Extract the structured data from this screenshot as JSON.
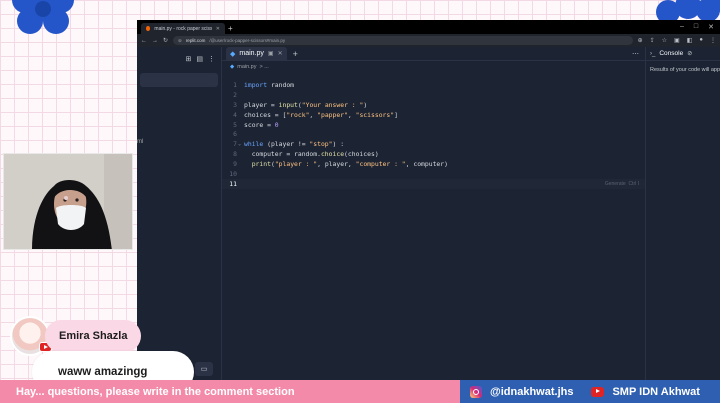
{
  "browser": {
    "tab_title": "main.py - rock paper scissors",
    "url_host": "replit.com",
    "url_path": "/@user/rock-papper-scissors#main.py"
  },
  "editor": {
    "tab_label": "main.py",
    "breadcrumb_file": "main.py",
    "breadcrumb_rest": "> ...",
    "generate_hint": "Generate  Ctrl I",
    "lines": [
      {
        "n": "1",
        "parts": [
          [
            "kw",
            "import"
          ],
          [
            "t",
            " random"
          ]
        ]
      },
      {
        "n": "2",
        "parts": []
      },
      {
        "n": "3",
        "parts": [
          [
            "t",
            "player = "
          ],
          [
            "fn",
            "input"
          ],
          [
            "t",
            "("
          ],
          [
            "str",
            "\"Your answer : \""
          ],
          [
            "t",
            ")"
          ]
        ]
      },
      {
        "n": "4",
        "parts": [
          [
            "t",
            "choices = ["
          ],
          [
            "str",
            "\"rock\""
          ],
          [
            "t",
            ", "
          ],
          [
            "str",
            "\"papper\""
          ],
          [
            "t",
            ", "
          ],
          [
            "str",
            "\"scissors\""
          ],
          [
            "t",
            "]"
          ]
        ]
      },
      {
        "n": "5",
        "parts": [
          [
            "t",
            "score = "
          ],
          [
            "num-lit",
            "0"
          ]
        ]
      },
      {
        "n": "6",
        "parts": []
      },
      {
        "n": "7",
        "parts": [
          [
            "kw",
            "while"
          ],
          [
            "t",
            " (player != "
          ],
          [
            "str",
            "\"stop\""
          ],
          [
            "t",
            ") :"
          ]
        ]
      },
      {
        "n": "8",
        "parts": [
          [
            "t",
            "  computer = random."
          ],
          [
            "fn",
            "choice"
          ],
          [
            "t",
            "(choices)"
          ]
        ]
      },
      {
        "n": "9",
        "parts": [
          [
            "t",
            "  "
          ],
          [
            "fn",
            "print"
          ],
          [
            "t",
            "("
          ],
          [
            "str",
            "\"player : \""
          ],
          [
            "t",
            ", player, "
          ],
          [
            "str",
            "\"computer : \""
          ],
          [
            "t",
            ", computer)"
          ]
        ]
      },
      {
        "n": "10",
        "parts": []
      },
      {
        "n": "11",
        "parts": []
      }
    ]
  },
  "sidebar": {
    "partial_text": "ml"
  },
  "console": {
    "title": "Console",
    "body": "Results of your code will appear here"
  },
  "chat": {
    "name": "Emira Shazla",
    "message": "waww amazingg"
  },
  "ticker": {
    "left_text": "Hay... questions, please write in the comment section",
    "instagram": "@idnakhwat.jhs",
    "youtube": "SMP IDN Akhwat"
  },
  "colors": {
    "ticker_pink": "#f48aa9",
    "ticker_blue": "#2f5fb0",
    "editor_bg": "#1c2333"
  }
}
